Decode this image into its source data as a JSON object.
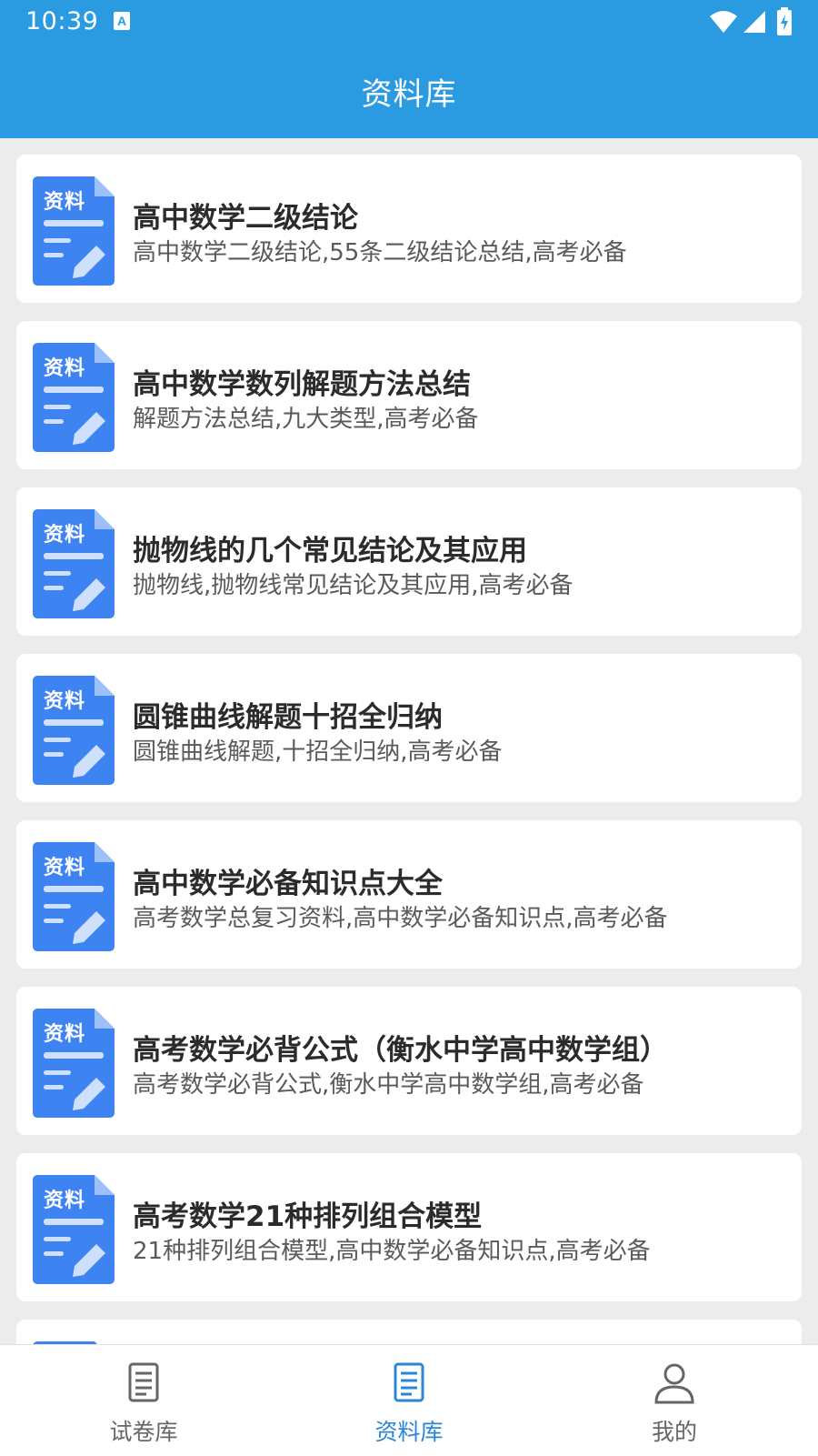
{
  "status": {
    "time": "10:39"
  },
  "header": {
    "title": "资料库"
  },
  "doc_badge": "资料",
  "colors": {
    "header_bg": "#2a9be0",
    "icon_blue": "#3d83f2",
    "tab_active": "#2a86d6"
  },
  "items": [
    {
      "title": "高中数学二级结论",
      "desc": "高中数学二级结论,55条二级结论总结,高考必备"
    },
    {
      "title": "高中数学数列解题方法总结",
      "desc": "解题方法总结,九大类型,高考必备"
    },
    {
      "title": "抛物线的几个常见结论及其应用",
      "desc": "抛物线,抛物线常见结论及其应用,高考必备"
    },
    {
      "title": "圆锥曲线解题十招全归纳",
      "desc": "圆锥曲线解题,十招全归纳,高考必备"
    },
    {
      "title": "高中数学必备知识点大全",
      "desc": "高考数学总复习资料,高中数学必备知识点,高考必备"
    },
    {
      "title": "高考数学必背公式（衡水中学高中数学组）",
      "desc": "高考数学必背公式,衡水中学高中数学组,高考必备"
    },
    {
      "title": "高考数学21种排列组合模型",
      "desc": "21种排列组合模型,高中数学必备知识点,高考必备"
    }
  ],
  "tabs": [
    {
      "label": "试卷库",
      "icon": "exam-paper-icon",
      "active": false
    },
    {
      "label": "资料库",
      "icon": "document-list-icon",
      "active": true
    },
    {
      "label": "我的",
      "icon": "person-icon",
      "active": false
    }
  ]
}
